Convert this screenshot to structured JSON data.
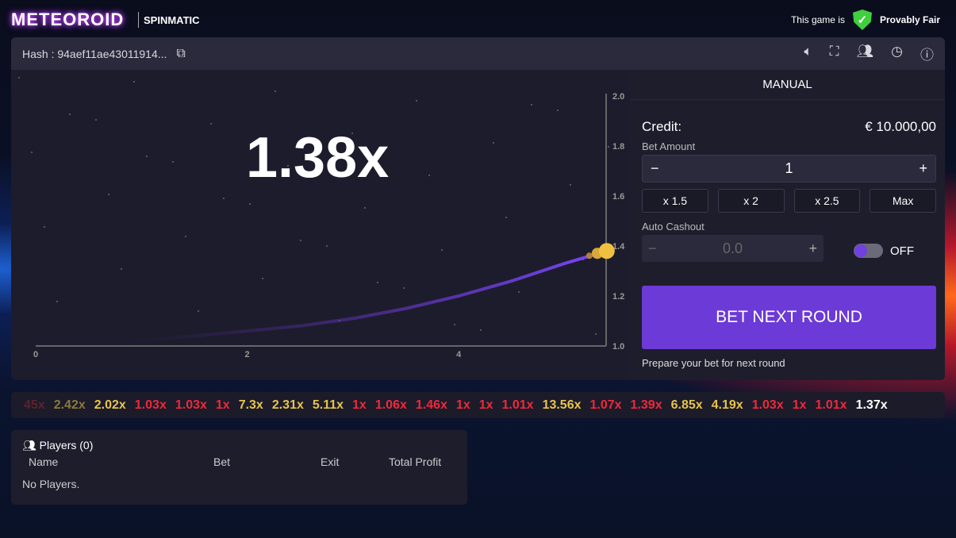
{
  "header": {
    "logo": "METEOROID",
    "brand": "SPINMATIC",
    "fair_prefix": "This game is",
    "fair_label": "Provably Fair"
  },
  "toolbar": {
    "hash": "Hash : 94aef11ae43011914...",
    "icons": [
      "copy-icon",
      "sound-icon",
      "fullscreen-icon",
      "users-icon",
      "history-icon",
      "help-icon"
    ]
  },
  "game": {
    "multiplier": "1.38x",
    "x_ticks": [
      "0",
      "2",
      "4"
    ],
    "y_ticks": [
      "2.0",
      "1.8",
      "1.6",
      "1.4",
      "1.2",
      "1.0"
    ],
    "current_value": 1.38
  },
  "chart_data": {
    "type": "line",
    "xlim": [
      0,
      5.4
    ],
    "ylim": [
      1.0,
      2.0
    ],
    "x": [
      0.9,
      1.5,
      2,
      2.5,
      3,
      3.5,
      4,
      4.5,
      5,
      5.4
    ],
    "y": [
      1.02,
      1.04,
      1.06,
      1.08,
      1.11,
      1.15,
      1.2,
      1.26,
      1.33,
      1.38
    ]
  },
  "panel": {
    "tab": "MANUAL",
    "credit_label": "Credit:",
    "credit_value": "€ 10.000,00",
    "bet_amount_label": "Bet Amount",
    "bet_amount": "1",
    "quick": [
      "x 1.5",
      "x 2",
      "x 2.5",
      "Max"
    ],
    "auto_cashout_label": "Auto Cashout",
    "auto_cashout_placeholder": "0.0",
    "toggle_label": "OFF",
    "bet_button": "BET NEXT ROUND",
    "status": "Prepare your bet for next round"
  },
  "history": [
    {
      "v": "45x",
      "c": "#5a2330"
    },
    {
      "v": "2.42x",
      "c": "#8a7a3a"
    },
    {
      "v": "2.02x",
      "c": "#e8c44a"
    },
    {
      "v": "1.03x",
      "c": "#f0283c"
    },
    {
      "v": "1.03x",
      "c": "#f0283c"
    },
    {
      "v": "1x",
      "c": "#f0283c"
    },
    {
      "v": "7.3x",
      "c": "#e8c44a"
    },
    {
      "v": "2.31x",
      "c": "#e8c44a"
    },
    {
      "v": "5.11x",
      "c": "#e8c44a"
    },
    {
      "v": "1x",
      "c": "#f0283c"
    },
    {
      "v": "1.06x",
      "c": "#f0283c"
    },
    {
      "v": "1.46x",
      "c": "#f0283c"
    },
    {
      "v": "1x",
      "c": "#f0283c"
    },
    {
      "v": "1x",
      "c": "#f0283c"
    },
    {
      "v": "1.01x",
      "c": "#f0283c"
    },
    {
      "v": "13.56x",
      "c": "#e8c44a"
    },
    {
      "v": "1.07x",
      "c": "#f0283c"
    },
    {
      "v": "1.39x",
      "c": "#f0283c"
    },
    {
      "v": "6.85x",
      "c": "#e8c44a"
    },
    {
      "v": "4.19x",
      "c": "#e8c44a"
    },
    {
      "v": "1.03x",
      "c": "#f0283c"
    },
    {
      "v": "1x",
      "c": "#f0283c"
    },
    {
      "v": "1.01x",
      "c": "#f0283c"
    },
    {
      "v": "1.37x",
      "c": "#ffffff"
    }
  ],
  "players": {
    "title": "Players (0)",
    "columns": [
      "Name",
      "Bet",
      "Exit",
      "Total Profit"
    ],
    "empty": "No Players."
  }
}
